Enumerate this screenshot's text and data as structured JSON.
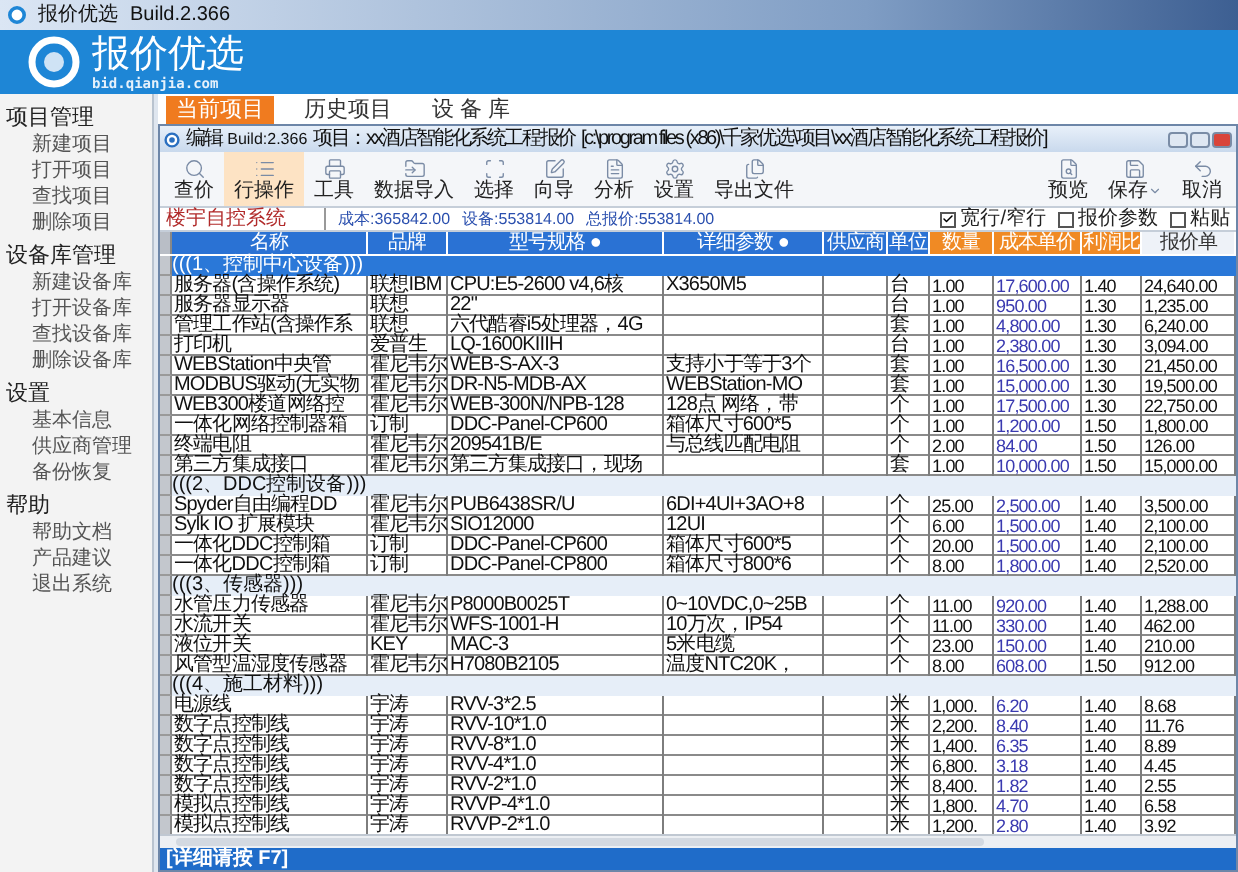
{
  "window": {
    "title": "报价优选",
    "build": "Build.2.366"
  },
  "header": {
    "brand": "报价优选",
    "site": "bid.qianjia.com"
  },
  "sidebar": [
    {
      "title": "项目管理",
      "items": [
        "新建项目",
        "打开项目",
        "查找项目",
        "删除项目"
      ]
    },
    {
      "title": "设备库管理",
      "items": [
        "新建设备库",
        "打开设备库",
        "查找设备库",
        "删除设备库"
      ]
    },
    {
      "title": "设置",
      "items": [
        "基本信息",
        "供应商管理",
        "备份恢复"
      ]
    },
    {
      "title": "帮助",
      "items": [
        "帮助文档",
        "产品建议",
        "退出系统"
      ]
    }
  ],
  "tabs": [
    {
      "label": "当前项目",
      "selected": true
    },
    {
      "label": "历史项目",
      "selected": false
    },
    {
      "label": "设 备 库",
      "selected": false
    }
  ],
  "editor": {
    "title": "编辑",
    "build": "Build:2.366",
    "project": "项目：xx酒店智能化系统工程报价",
    "path": "[c:\\program files (x86)\\千家优选\\项目\\xx酒店智能化系统工程报价]"
  },
  "toolbar": [
    {
      "label": "查价",
      "selected": false
    },
    {
      "label": "行操作",
      "selected": true
    },
    {
      "label": "工具",
      "selected": false
    },
    {
      "label": "数据导入",
      "selected": false
    },
    {
      "label": "选择",
      "selected": false
    },
    {
      "label": "向导",
      "selected": false
    },
    {
      "label": "分析",
      "selected": false
    },
    {
      "label": "设置",
      "selected": false
    },
    {
      "label": "导出文件",
      "selected": false
    }
  ],
  "toolbar_right": [
    "预览",
    "保存",
    "取消"
  ],
  "info": {
    "system": "楼宇自控系统",
    "cost": "成本:365842.00",
    "equipment": "设备:553814.00",
    "total": "总报价:553814.00"
  },
  "options": [
    {
      "label": "宽行/窄行",
      "checked": true
    },
    {
      "label": "报价参数",
      "checked": false
    },
    {
      "label": "粘贴",
      "checked": false
    }
  ],
  "columns": [
    {
      "label": "名称",
      "color": "#2a72d4"
    },
    {
      "label": "品牌",
      "color": "#2a72d4"
    },
    {
      "label": "型号规格 ●",
      "color": "#2a72d4"
    },
    {
      "label": "详细参数 ●",
      "color": "#2a72d4"
    },
    {
      "label": "供应商",
      "color": "#2a72d4"
    },
    {
      "label": "单位",
      "color": "#2a72d4"
    },
    {
      "label": "数量",
      "color": "#f08a24"
    },
    {
      "label": "成本单价",
      "color": "#f08a24"
    },
    {
      "label": "利润比",
      "color": "#f08a24"
    },
    {
      "label": "报价单",
      "color": "#eef2f8"
    }
  ],
  "rows": [
    {
      "kind": "group",
      "label": "(((1、控制中心设备)))",
      "selected": true
    },
    {
      "kind": "item",
      "cells": [
        "服务器(含操作系统)",
        "联想IBM",
        "CPU:E5-2600 v4,6核",
        "X3650M5",
        null,
        "台",
        "1.00",
        "17,600.00",
        "1.40",
        "24,640.00"
      ]
    },
    {
      "kind": "item",
      "cells": [
        "服务器显示器",
        "联想",
        "22\"",
        null,
        null,
        "台",
        "1.00",
        "950.00",
        "1.30",
        "1,235.00"
      ]
    },
    {
      "kind": "item",
      "cells": [
        "管理工作站(含操作系",
        "联想",
        "六代酷睿i5处理器，4G",
        null,
        null,
        "套",
        "1.00",
        "4,800.00",
        "1.30",
        "6,240.00"
      ]
    },
    {
      "kind": "item",
      "cells": [
        "打印机",
        "爱普生",
        "LQ-1600KIIIH",
        null,
        null,
        "台",
        "1.00",
        "2,380.00",
        "1.30",
        "3,094.00"
      ]
    },
    {
      "kind": "item",
      "cells": [
        "WEBStation中央管",
        "霍尼韦尔",
        "WEB-S-AX-3",
        "支持小于等于3个",
        null,
        "套",
        "1.00",
        "16,500.00",
        "1.30",
        "21,450.00"
      ]
    },
    {
      "kind": "item",
      "cells": [
        "MODBUS驱动(无实物",
        "霍尼韦尔",
        "DR-N5-MDB-AX",
        "WEBStation-MO",
        null,
        "套",
        "1.00",
        "15,000.00",
        "1.30",
        "19,500.00"
      ]
    },
    {
      "kind": "item",
      "cells": [
        "WEB300楼道网络控",
        "霍尼韦尔",
        "WEB-300N/NPB-128",
        "128点 网络，带",
        null,
        "个",
        "1.00",
        "17,500.00",
        "1.30",
        "22,750.00"
      ]
    },
    {
      "kind": "item",
      "cells": [
        "一体化网络控制器箱",
        "订制",
        "DDC-Panel-CP600",
        "箱体尺寸600*5",
        null,
        "个",
        "1.00",
        "1,200.00",
        "1.50",
        "1,800.00"
      ]
    },
    {
      "kind": "item",
      "cells": [
        "终端电阻",
        "霍尼韦尔",
        "209541B/E",
        "与总线匹配电阻",
        null,
        "个",
        "2.00",
        "84.00",
        "1.50",
        "126.00"
      ]
    },
    {
      "kind": "item",
      "cells": [
        "第三方集成接口",
        "霍尼韦尔",
        "第三方集成接口，现场",
        null,
        null,
        "套",
        "1.00",
        "10,000.00",
        "1.50",
        "15,000.00"
      ]
    },
    {
      "kind": "group",
      "label": "(((2、DDC控制设备)))",
      "selected": false
    },
    {
      "kind": "item",
      "cells": [
        "Spyder自由编程DD",
        "霍尼韦尔",
        "PUB6438SR/U",
        "6DI+4UI+3AO+8",
        null,
        "个",
        "25.00",
        "2,500.00",
        "1.40",
        "3,500.00"
      ]
    },
    {
      "kind": "item",
      "cells": [
        "Sylk IO 扩展模块",
        "霍尼韦尔",
        "SIO12000",
        "12UI",
        null,
        "个",
        "6.00",
        "1,500.00",
        "1.40",
        "2,100.00"
      ]
    },
    {
      "kind": "item",
      "cells": [
        "一体化DDC控制箱",
        "订制",
        "DDC-Panel-CP600",
        "箱体尺寸600*5",
        null,
        "个",
        "20.00",
        "1,500.00",
        "1.40",
        "2,100.00"
      ]
    },
    {
      "kind": "item",
      "cells": [
        "一体化DDC控制箱",
        "订制",
        "DDC-Panel-CP800",
        "箱体尺寸800*6",
        null,
        "个",
        "8.00",
        "1,800.00",
        "1.40",
        "2,520.00"
      ]
    },
    {
      "kind": "group",
      "label": "(((3、传感器)))",
      "selected": false
    },
    {
      "kind": "item",
      "cells": [
        "水管压力传感器",
        "霍尼韦尔",
        "P8000B0025T",
        "0~10VDC,0~25B",
        null,
        "个",
        "11.00",
        "920.00",
        "1.40",
        "1,288.00"
      ]
    },
    {
      "kind": "item",
      "cells": [
        "水流开关",
        "霍尼韦尔",
        "WFS-1001-H",
        "10万次，IP54",
        null,
        "个",
        "11.00",
        "330.00",
        "1.40",
        "462.00"
      ]
    },
    {
      "kind": "item",
      "cells": [
        "液位开关",
        "KEY",
        "MAC-3",
        "5米电缆",
        null,
        "个",
        "23.00",
        "150.00",
        "1.40",
        "210.00"
      ]
    },
    {
      "kind": "item",
      "cells": [
        "风管型温湿度传感器",
        "霍尼韦尔",
        "H7080B2105",
        "温度NTC20K，",
        null,
        "个",
        "8.00",
        "608.00",
        "1.50",
        "912.00"
      ]
    },
    {
      "kind": "group",
      "label": "(((4、施工材料)))",
      "selected": false
    },
    {
      "kind": "item",
      "cells": [
        "电源线",
        "宇涛",
        "RVV-3*2.5",
        null,
        null,
        "米",
        "1,000.",
        "6.20",
        "1.40",
        "8.68"
      ]
    },
    {
      "kind": "item",
      "cells": [
        "数字点控制线",
        "宇涛",
        "RVV-10*1.0",
        null,
        null,
        "米",
        "2,200.",
        "8.40",
        "1.40",
        "11.76"
      ]
    },
    {
      "kind": "item",
      "cells": [
        "数字点控制线",
        "宇涛",
        "RVV-8*1.0",
        null,
        null,
        "米",
        "1,400.",
        "6.35",
        "1.40",
        "8.89"
      ]
    },
    {
      "kind": "item",
      "cells": [
        "数字点控制线",
        "宇涛",
        "RVV-4*1.0",
        null,
        null,
        "米",
        "6,800.",
        "3.18",
        "1.40",
        "4.45"
      ]
    },
    {
      "kind": "item",
      "cells": [
        "数字点控制线",
        "宇涛",
        "RVV-2*1.0",
        null,
        null,
        "米",
        "8,400.",
        "1.82",
        "1.40",
        "2.55"
      ]
    },
    {
      "kind": "item",
      "cells": [
        "模拟点控制线",
        "宇涛",
        "RVVP-4*1.0",
        null,
        null,
        "米",
        "1,800.",
        "4.70",
        "1.40",
        "6.58"
      ]
    },
    {
      "kind": "item",
      "cells": [
        "模拟点控制线",
        "宇涛",
        "RVVP-2*1.0",
        null,
        null,
        "米",
        "1,200.",
        "2.80",
        "1.40",
        "3.92"
      ]
    }
  ],
  "status_bar": "[详细请按 F7]"
}
